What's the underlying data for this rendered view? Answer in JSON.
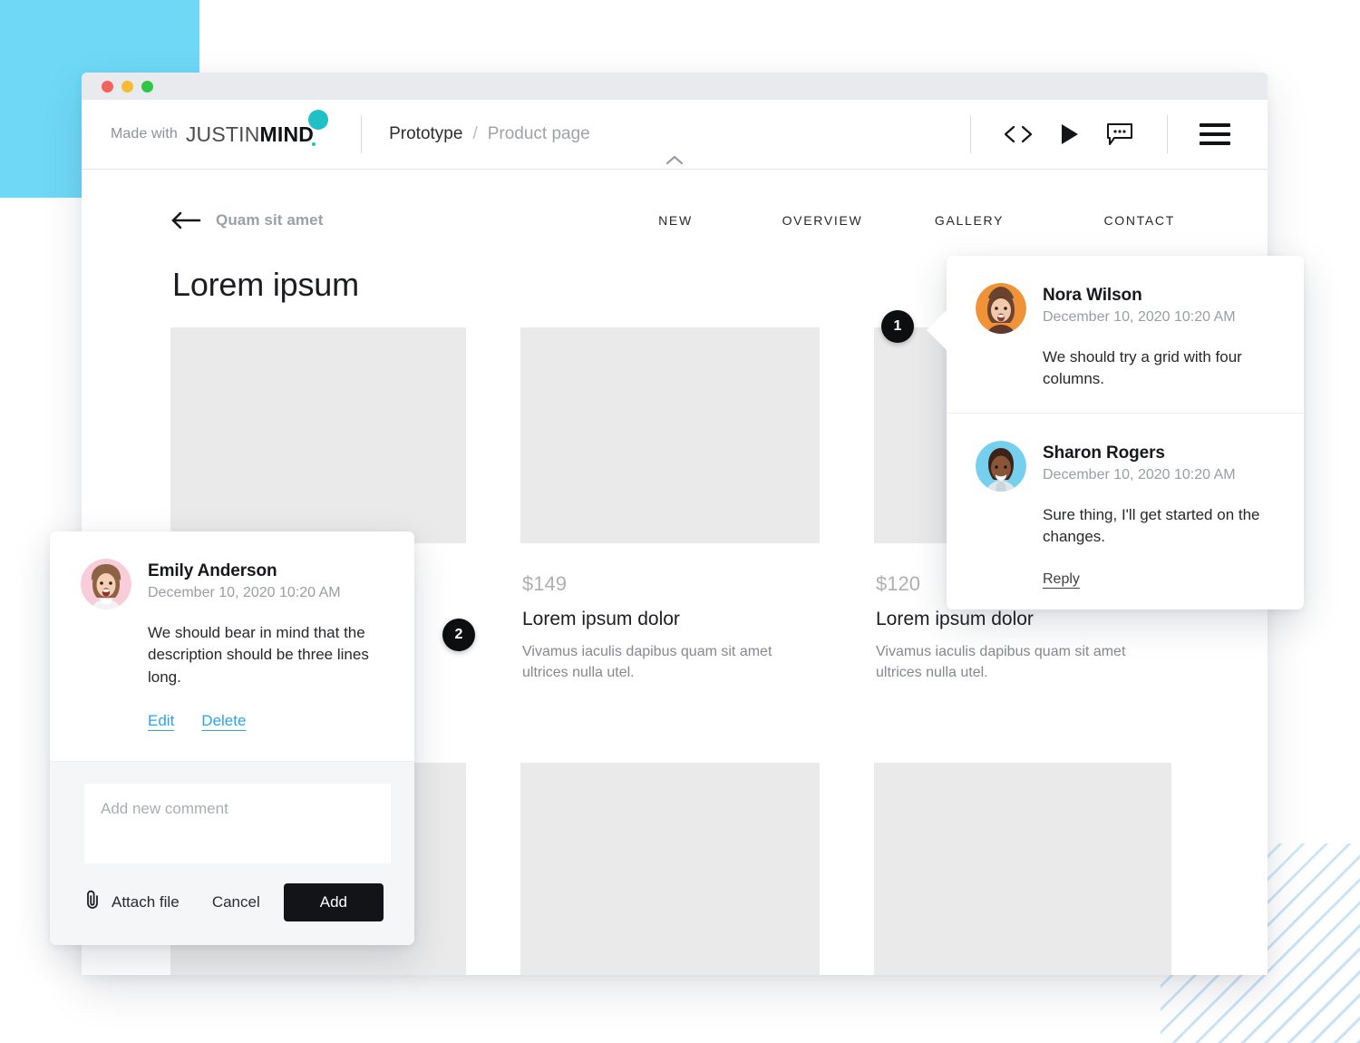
{
  "window": {
    "titlebar_dots": [
      "red",
      "yellow",
      "green"
    ],
    "brand": {
      "made_with": "Made with",
      "logo_part1": "JUSTIN",
      "logo_part2": "MIND",
      "dot_color": "#20c0c7"
    },
    "breadcrumb": {
      "root": "Prototype",
      "separator": "/",
      "current": "Product page"
    },
    "toolbar_icons": [
      {
        "name": "code-icon",
        "glyph": "< >"
      },
      {
        "name": "play-icon",
        "glyph": "play"
      },
      {
        "name": "comment-icon",
        "glyph": "speech-bubble"
      },
      {
        "name": "hamburger-menu-icon",
        "glyph": "menu"
      }
    ],
    "collapse_chevron": "⌃"
  },
  "page": {
    "back_label": "Quam sit amet",
    "menu": [
      "NEW",
      "OVERVIEW",
      "GALLERY",
      "CONTACT"
    ],
    "title": "Lorem ipsum",
    "products": [
      {
        "price": "",
        "title": "",
        "desc": ""
      },
      {
        "price": "$149",
        "title": "Lorem ipsum dolor",
        "desc": "Vivamus iaculis dapibus quam sit amet ultrices nulla utel."
      },
      {
        "price": "$120",
        "title": "Lorem ipsum dolor",
        "desc": "Vivamus iaculis dapibus quam sit amet ultrices nulla utel."
      }
    ]
  },
  "pins": [
    {
      "number": "1"
    },
    {
      "number": "2"
    }
  ],
  "thread_panel": {
    "comments": [
      {
        "author": "Nora Wilson",
        "date": "December 10, 2020 10:20 AM",
        "body": "We should try a grid with four columns.",
        "avatar_bg": "#f09338"
      },
      {
        "author": "Sharon Rogers",
        "date": "December 10, 2020 10:20 AM",
        "body": "Sure thing, I'll get started on the changes.",
        "avatar_bg": "#74d0ee"
      }
    ],
    "reply_label": "Reply"
  },
  "editor_panel": {
    "comment": {
      "author": "Emily Anderson",
      "date": "December 10, 2020 10:20 AM",
      "body": "We should bear in mind that the description should be three lines long.",
      "avatar_bg": "#f8ccd8"
    },
    "edit_label": "Edit",
    "delete_label": "Delete",
    "input_placeholder": "Add new comment",
    "input_value": "",
    "attach_label": "Attach file",
    "cancel_label": "Cancel",
    "add_label": "Add"
  },
  "colors": {
    "accent_cyan": "#6FD8F7",
    "link_blue": "#2aa4ec",
    "placeholder_grey": "#eaeaea",
    "dark": "#131417"
  }
}
